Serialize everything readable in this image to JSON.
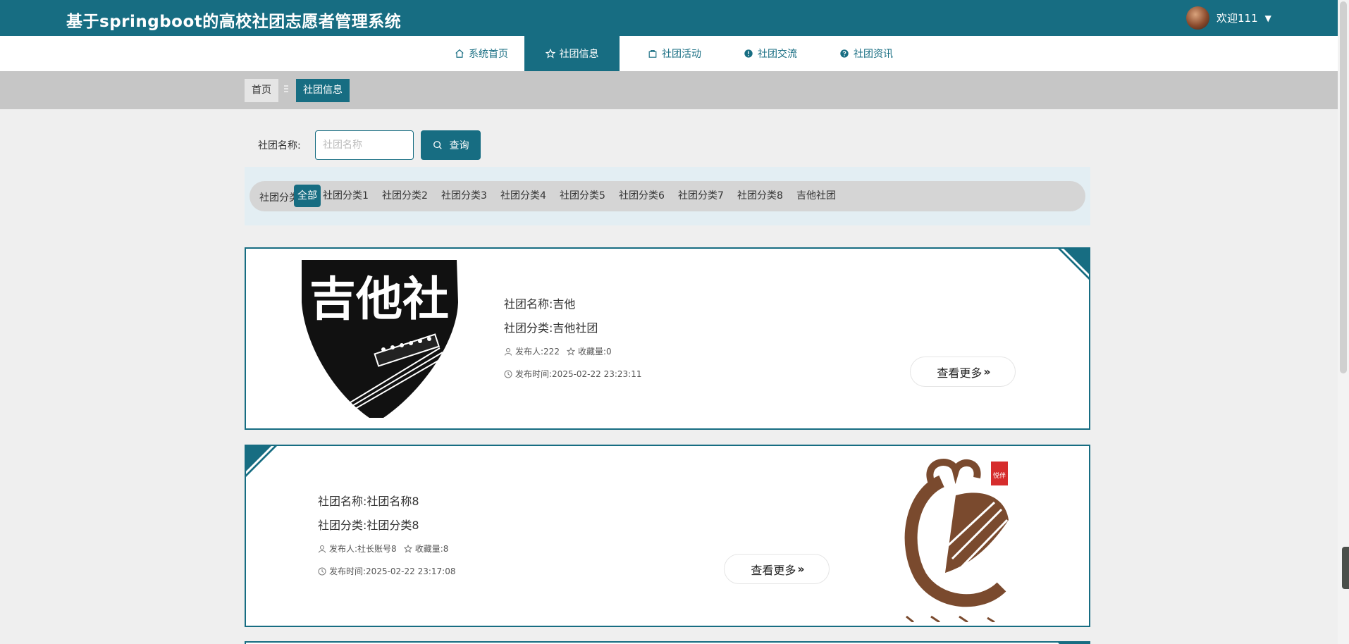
{
  "app": {
    "title": "基于springboot的高校社团志愿者管理系统",
    "user_greeting": "欢迎111"
  },
  "nav": {
    "items": [
      {
        "label": "系统首页",
        "icon": "home-icon"
      },
      {
        "label": "社团信息",
        "icon": "star-icon",
        "active": true
      },
      {
        "label": "社团活动",
        "icon": "bag-icon"
      },
      {
        "label": "社团交流",
        "icon": "alert-circle-icon"
      },
      {
        "label": "社团资讯",
        "icon": "help-circle-icon"
      }
    ]
  },
  "breadcrumb": {
    "home": "首页",
    "current": "社团信息"
  },
  "search": {
    "label": "社团名称:",
    "placeholder": "社团名称",
    "value": "",
    "button": "查询"
  },
  "filter": {
    "label": "社团分类:",
    "chips": [
      "全部",
      "社团分类1",
      "社团分类2",
      "社团分类3",
      "社团分类4",
      "社团分类5",
      "社团分类6",
      "社团分类7",
      "社团分类8",
      "吉他社团"
    ],
    "active_index": 0
  },
  "cards": [
    {
      "name": "社团名称:吉他",
      "category": "社团分类:吉他社团",
      "publisher": "发布人:222",
      "favorites": "收藏量:0",
      "time": "发布时间:2025-02-22 23:23:11",
      "more": "查看更多",
      "image_text": "吉他社"
    },
    {
      "name": "社团名称:社团名称8",
      "category": "社团分类:社团分类8",
      "publisher": "发布人:社长账号8",
      "favorites": "收藏量:8",
      "time": "发布时间:2025-02-22 23:17:08",
      "more": "查看更多",
      "image_text": "悦伴"
    }
  ],
  "colors": {
    "primary": "#176d82",
    "page_bg": "#efefef",
    "crumb_bg": "#c6c6c6",
    "filter_bg": "#e3eef3"
  }
}
